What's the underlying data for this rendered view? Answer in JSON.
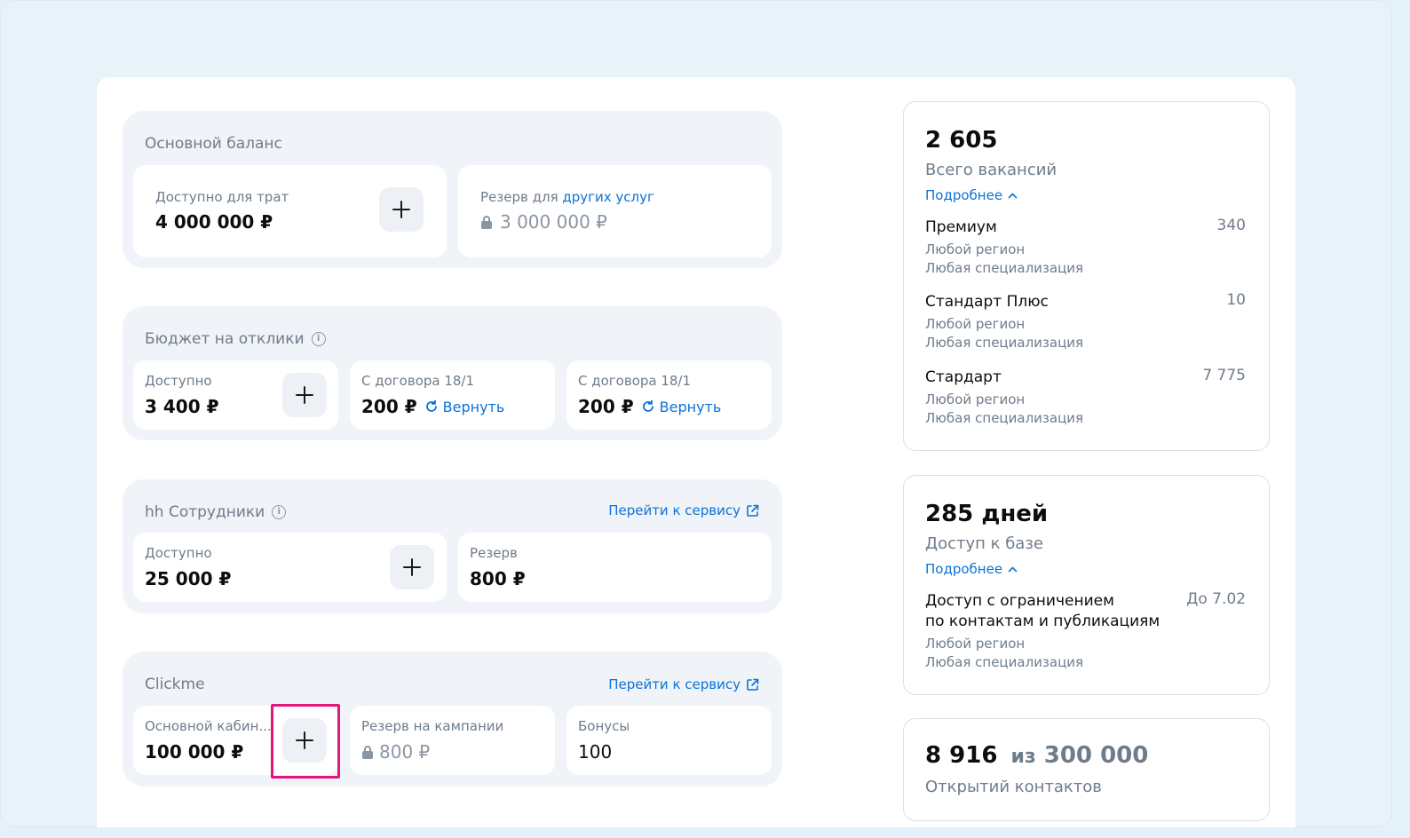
{
  "main_balance": {
    "title": "Основной баланс",
    "available_label": "Доступно для трат",
    "available_value": "4 000 000 ₽",
    "reserve_label_prefix": "Резерв для",
    "reserve_label_link": "других услуг",
    "reserve_value": "3 000 000 ₽"
  },
  "responses_budget": {
    "title": "Бюджет на отклики",
    "available_label": "Доступно",
    "available_value": "3 400 ₽",
    "contracts": [
      {
        "label": "С договора 18/1",
        "value": "200 ₽",
        "action": "Вернуть"
      },
      {
        "label": "С договора 18/1",
        "value": "200 ₽",
        "action": "Вернуть"
      }
    ]
  },
  "hh_employees": {
    "title": "hh Сотрудники",
    "service_link": "Перейти к сервису",
    "available_label": "Доступно",
    "available_value": "25 000 ₽",
    "reserve_label": "Резерв",
    "reserve_value": "800 ₽"
  },
  "clickme": {
    "title": "Clickme",
    "service_link": "Перейти к сервису",
    "cabinet_label": "Основной кабин...",
    "cabinet_value": "100 000 ₽",
    "campaign_reserve_label": "Резерв на кампании",
    "campaign_reserve_value": "800 ₽",
    "bonus_label": "Бонусы",
    "bonus_value": "100"
  },
  "vacancies_card": {
    "total": "2 605",
    "subtitle": "Всего вакансий",
    "more": "Подробнее",
    "items": [
      {
        "name": "Премиум",
        "count": "340",
        "region": "Любой регион",
        "spec": "Любая специализация"
      },
      {
        "name": "Стандарт Плюс",
        "count": "10",
        "region": "Любой регион",
        "spec": "Любая специализация"
      },
      {
        "name": "Стардарт",
        "count": "7 775",
        "region": "Любой регион",
        "spec": "Любая специализация"
      }
    ]
  },
  "base_access_card": {
    "total": "285 дней",
    "subtitle": "Доступ к базе",
    "more": "Подробнее",
    "item": {
      "name_line1": "Доступ с ограничением",
      "name_line2": "по контактам и публикациям",
      "until": "До 7.02",
      "region": "Любой регион",
      "spec": "Любая специализация"
    }
  },
  "contacts_card": {
    "opened": "8 916",
    "of_label": "из",
    "limit": "300 000",
    "subtitle": "Открытий контактов"
  },
  "colors": {
    "accent_link": "#0b72d8",
    "highlight": "#e5157e",
    "group_bg": "#f0f3f8",
    "page_bg": "#e5f1f9"
  }
}
